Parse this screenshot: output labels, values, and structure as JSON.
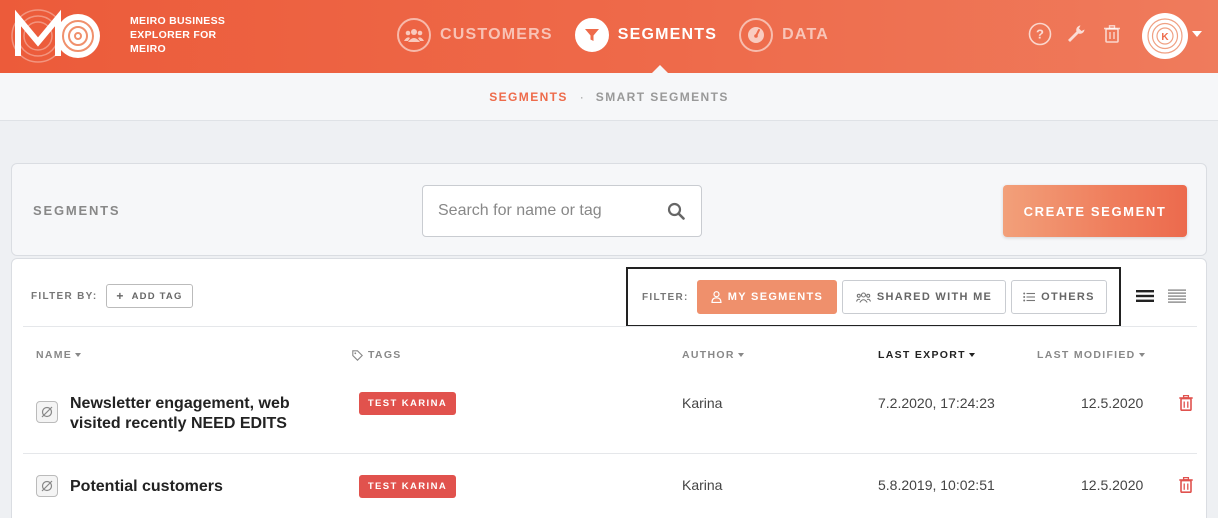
{
  "brand": {
    "logo_text": "MO",
    "line1": "MEIRO BUSINESS",
    "line2": "EXPLORER FOR",
    "line3": "MEIRO"
  },
  "nav": {
    "customers": "CUSTOMERS",
    "segments": "SEGMENTS",
    "data": "DATA"
  },
  "user": {
    "avatar_initial": "K"
  },
  "subnav": {
    "segments": "SEGMENTS",
    "separator": "·",
    "smart_segments": "SMART SEGMENTS"
  },
  "segments_header": {
    "title": "SEGMENTS",
    "search_placeholder": "Search for name or tag",
    "create_label": "CREATE SEGMENT"
  },
  "filters": {
    "filter_by_label": "FILTER BY:",
    "add_tag_label": "ADD TAG",
    "filter_label": "FILTER:",
    "my_segments": "MY SEGMENTS",
    "shared_with_me": "SHARED WITH ME",
    "others": "OTHERS"
  },
  "table": {
    "columns": {
      "name": "NAME",
      "tags": "TAGS",
      "author": "AUTHOR",
      "last_export": "LAST EXPORT",
      "last_modified": "LAST MODIFIED"
    },
    "rows": [
      {
        "name_line1": "Newsletter engagement, web",
        "name_line2": "visited recently NEED EDITS",
        "tag": "TEST KARINA",
        "author": "Karina",
        "last_export": "7.2.2020, 17:24:23",
        "last_modified": "12.5.2020"
      },
      {
        "name": "Potential customers",
        "tag": "TEST KARINA",
        "author": "Karina",
        "last_export": "5.8.2019, 10:02:51",
        "last_modified": "12.5.2020"
      }
    ]
  },
  "colors": {
    "accent": "#ee6b4b",
    "tag_red": "#e1524d",
    "trash_red": "#e0524e"
  }
}
